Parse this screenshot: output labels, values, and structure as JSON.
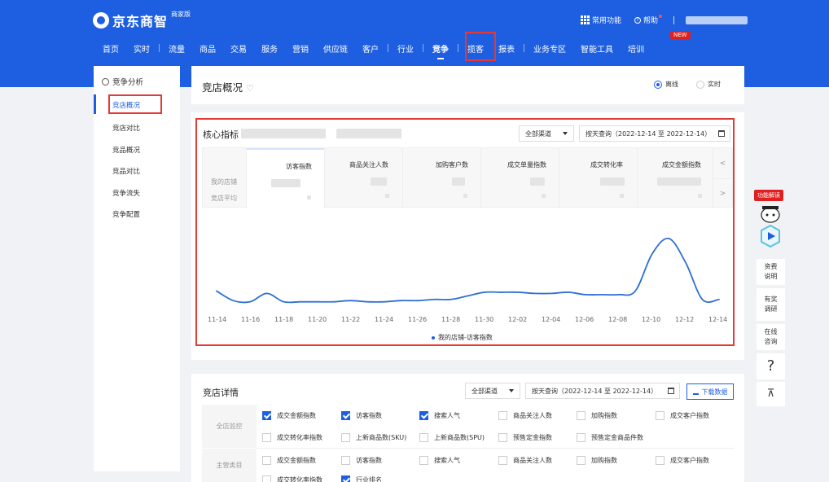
{
  "header": {
    "logo_text": "京东商智",
    "logo_sub": "商家版",
    "common_features": "常用功能",
    "help": "帮助",
    "nav": [
      "首页",
      "实时",
      "流量",
      "商品",
      "交易",
      "服务",
      "营销",
      "供应链",
      "客户",
      "行业",
      "竞争",
      "揽客",
      "报表",
      "业务专区",
      "智能工具",
      "培训"
    ],
    "active_nav": "竞争",
    "new_badge": "NEW"
  },
  "sidebar": {
    "title": "竞争分析",
    "items": [
      "竞店概况",
      "竞店对比",
      "竞品概况",
      "竞品对比",
      "竞争流失",
      "竞争配置"
    ]
  },
  "overview": {
    "title": "竞店概况",
    "radio_offline": "离线",
    "radio_realtime": "实时"
  },
  "core": {
    "title": "核心指标",
    "channel": "全部渠道",
    "date_query": "按天查询（2022-12-14 至 2022-12-14）",
    "row_labels": [
      "我的店铺",
      "竞店平均"
    ],
    "metrics": [
      "访客指数",
      "商品关注人数",
      "加购客户数",
      "成交单量指数",
      "成交转化率",
      "成交金额指数"
    ],
    "prev": "<",
    "next": ">",
    "x_ticks": [
      "11-14",
      "11-16",
      "11-18",
      "11-20",
      "11-22",
      "11-24",
      "11-26",
      "11-28",
      "11-30",
      "12-02",
      "12-04",
      "12-06",
      "12-08",
      "12-10",
      "12-12",
      "12-14"
    ],
    "legend": "我的店铺-访客指数"
  },
  "chart_data": {
    "type": "line",
    "x": [
      "11-14",
      "11-15",
      "11-16",
      "11-17",
      "11-18",
      "11-19",
      "11-20",
      "11-21",
      "11-22",
      "11-23",
      "11-24",
      "11-25",
      "11-26",
      "11-27",
      "11-28",
      "11-29",
      "11-30",
      "12-01",
      "12-02",
      "12-03",
      "12-04",
      "12-05",
      "12-06",
      "12-07",
      "12-08",
      "12-09",
      "12-10",
      "12-11",
      "12-12",
      "12-13",
      "12-14"
    ],
    "series": [
      {
        "name": "我的店铺-访客指数",
        "values": [
          14,
          6,
          5,
          12,
          5,
          5,
          5,
          5,
          6,
          5,
          5,
          6,
          6,
          7,
          7,
          10,
          13,
          13,
          13,
          12,
          12,
          13,
          11,
          11,
          11,
          14,
          45,
          58,
          38,
          7,
          7
        ]
      }
    ],
    "ylim": [
      0,
      75
    ],
    "grid": false,
    "legend": "bottom-center"
  },
  "detail": {
    "title": "竞店详情",
    "channel": "全部渠道",
    "date_query": "按天查询（2022-12-14 至 2022-12-14）",
    "download": "下载数据",
    "sections": [
      {
        "label": "全店监控",
        "options": [
          {
            "text": "成交金额指数",
            "checked": true
          },
          {
            "text": "访客指数",
            "checked": true
          },
          {
            "text": "搜索人气",
            "checked": true
          },
          {
            "text": "商品关注人数",
            "checked": false
          },
          {
            "text": "加购指数",
            "checked": false
          },
          {
            "text": "成交客户指数",
            "checked": false
          },
          {
            "text": "成交转化率指数",
            "checked": false
          },
          {
            "text": "上新商品数(SKU)",
            "checked": false
          },
          {
            "text": "上新商品数(SPU)",
            "checked": false
          },
          {
            "text": "预售定金指数",
            "checked": false
          },
          {
            "text": "预售定金商品件数",
            "checked": false
          }
        ]
      },
      {
        "label": "主营类目",
        "options": [
          {
            "text": "成交金额指数",
            "checked": false
          },
          {
            "text": "访客指数",
            "checked": false
          },
          {
            "text": "搜索人气",
            "checked": false
          },
          {
            "text": "商品关注人数",
            "checked": false
          },
          {
            "text": "加购指数",
            "checked": false
          },
          {
            "text": "成交客户指数",
            "checked": false
          },
          {
            "text": "成交转化率指数",
            "checked": false
          },
          {
            "text": "行业排名",
            "checked": true
          }
        ]
      }
    ]
  },
  "float": {
    "tag": "功能解读",
    "items": [
      "资费说明",
      "有奖调研",
      "在线咨询"
    ],
    "question": "?",
    "top": "⊼"
  },
  "colors": {
    "brand": "#1d5fe0",
    "highlight": "#e53935",
    "line": "#2d6fd2"
  }
}
